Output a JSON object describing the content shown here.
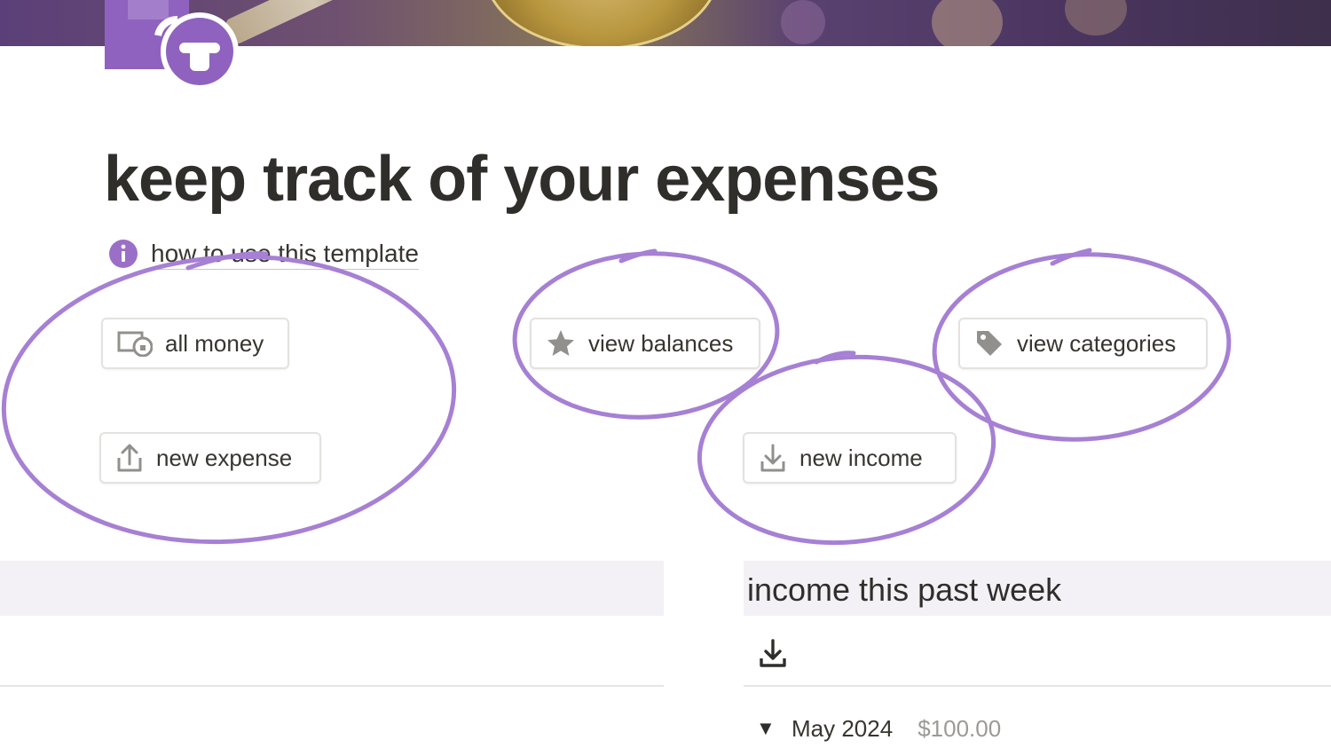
{
  "colors": {
    "accent_purple": "#9b6fc7",
    "page_icon_purple": "#8f62bf",
    "title_text": "#2f2e2b",
    "band_background": "#f3f1f6",
    "muted_text": "#9b9a97"
  },
  "page": {
    "icon": "money-cycle-icon",
    "title": "keep track of your expenses",
    "howto": {
      "icon": "info-icon",
      "label": "how to use this template"
    }
  },
  "buttons": {
    "all_money": {
      "label": "all money",
      "icon": "money-cycle-icon"
    },
    "new_expense": {
      "label": "new expense",
      "icon": "upload-icon"
    },
    "view_balances": {
      "label": "view balances",
      "icon": "star-icon"
    },
    "new_income": {
      "label": "new income",
      "icon": "download-icon"
    },
    "view_categories": {
      "label": "view categories",
      "icon": "tag-icon"
    }
  },
  "income_section": {
    "title": "income this past week",
    "toolbar_icon": "download-icon",
    "groups": [
      {
        "label": "May 2024",
        "amount": "$100.00",
        "expanded": true
      }
    ]
  }
}
